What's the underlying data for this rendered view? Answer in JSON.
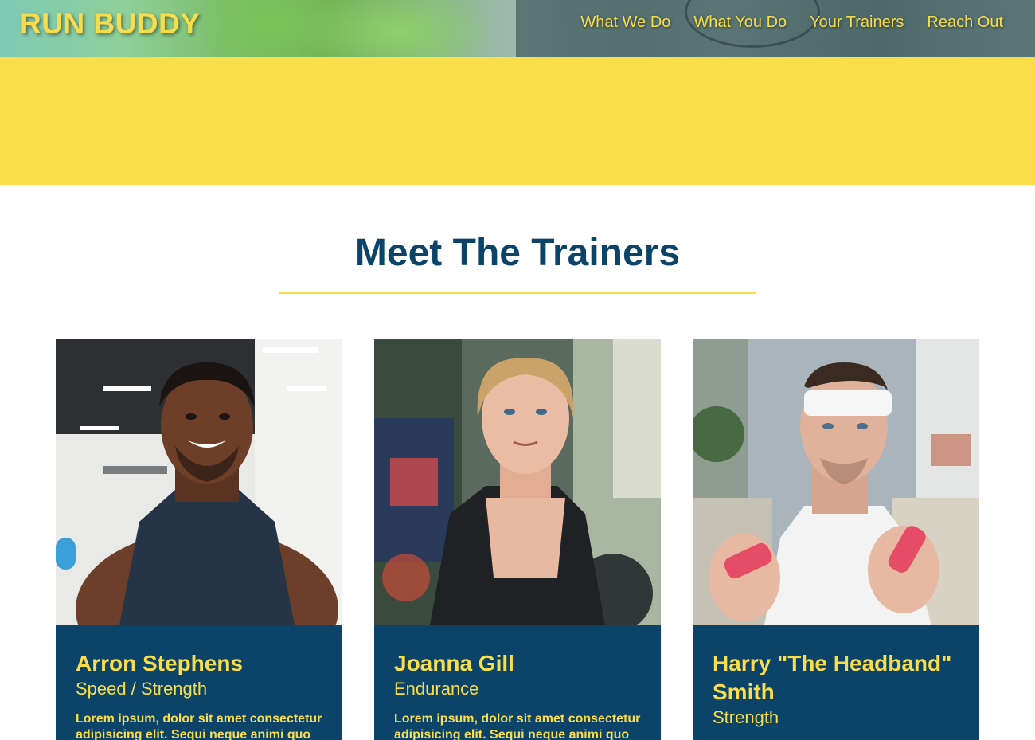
{
  "header": {
    "logo": "RUN BUDDY",
    "nav": [
      "What We Do",
      "What You Do",
      "Your Trainers",
      "Reach Out"
    ]
  },
  "main": {
    "section_title": "Meet The Trainers",
    "trainers": [
      {
        "name": "Arron Stephens",
        "role": "Speed / Strength",
        "bio": "Lorem ipsum, dolor sit amet consectetur adipisicing elit. Sequi neque animi quo"
      },
      {
        "name": "Joanna Gill",
        "role": "Endurance",
        "bio": "Lorem ipsum, dolor sit amet consectetur adipisicing elit. Sequi neque animi quo"
      },
      {
        "name": "Harry \"The Headband\" Smith",
        "role": "Strength",
        "bio": ""
      }
    ]
  }
}
